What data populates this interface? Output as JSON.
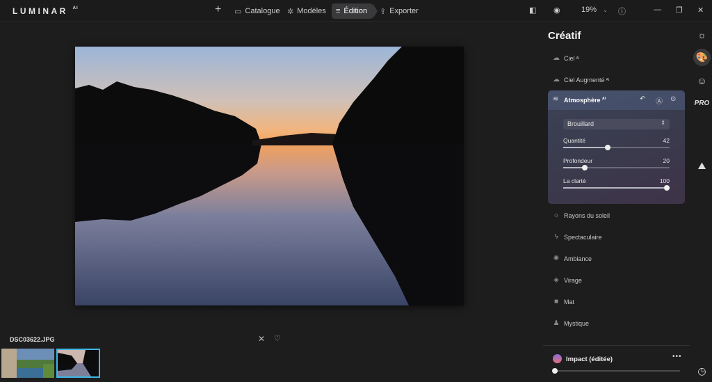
{
  "app": {
    "logo": "LUMINAR",
    "logo_suffix": "AI"
  },
  "toolbar": {
    "add_icon": "plus-icon",
    "catalogue": "Catalogue",
    "modeles": "Modèles",
    "edition": "Édition",
    "exporter": "Exporter",
    "zoom": "19%"
  },
  "viewer": {
    "filename": "DSC03622.JPG"
  },
  "panel": {
    "title": "Créatif",
    "tools_top": [
      {
        "label": "Ciel",
        "ai": "AI"
      },
      {
        "label": "Ciel Augmenté",
        "ai": "AI"
      }
    ],
    "atmosphere": {
      "title": "Atmosphère",
      "ai": "AI",
      "type": "Brouillard",
      "sliders": [
        {
          "label": "Quantité",
          "value": "42",
          "fraction": 0.42
        },
        {
          "label": "Profondeur",
          "value": "20",
          "fraction": 0.2
        },
        {
          "label": "La clarté",
          "value": "100",
          "fraction": 1.0
        }
      ]
    },
    "tools_bottom": [
      {
        "label": "Rayons du soleil"
      },
      {
        "label": "Spectaculaire"
      },
      {
        "label": "Ambiance"
      },
      {
        "label": "Virage"
      },
      {
        "label": "Mat"
      },
      {
        "label": "Mystique"
      }
    ],
    "preset": {
      "name": "Impact (éditée)",
      "amount": 0
    }
  },
  "right_icons": {
    "pro": "PRO"
  },
  "colors": {
    "accent": "#3fb7e6",
    "panel_bg": "#1d1d1e",
    "atmosphere_card": "#3c4256"
  }
}
